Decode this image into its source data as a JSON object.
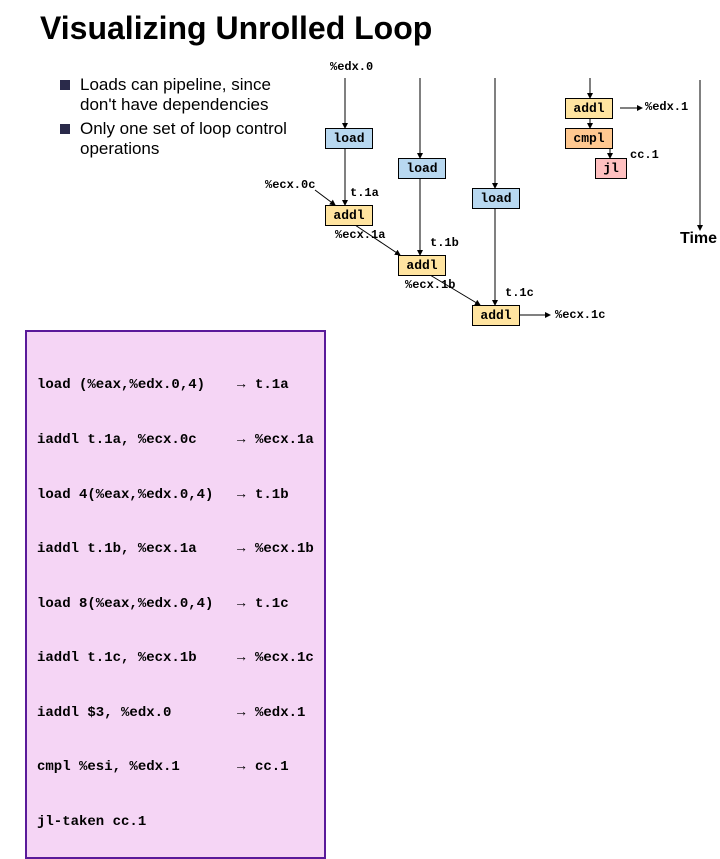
{
  "title": "Visualizing Unrolled Loop",
  "bullets": [
    "Loads can pipeline, since don't have dependencies",
    "Only one set of loop control operations"
  ],
  "code": {
    "lines": [
      {
        "l": "load (%eax,%edx.0,4)",
        "a": "→",
        "r": "t.1a"
      },
      {
        "l": "iaddl t.1a, %ecx.0c",
        "a": "→",
        "r": "%ecx.1a"
      },
      {
        "l": "load 4(%eax,%edx.0,4)",
        "a": "→",
        "r": "t.1b"
      },
      {
        "l": "iaddl t.1b, %ecx.1a",
        "a": "→",
        "r": "%ecx.1b"
      },
      {
        "l": "load 8(%eax,%edx.0,4)",
        "a": "→",
        "r": "t.1c"
      },
      {
        "l": "iaddl t.1c, %ecx.1b",
        "a": "→",
        "r": "%ecx.1c"
      },
      {
        "l": "iaddl $3, %edx.0",
        "a": "→",
        "r": "%edx.1"
      },
      {
        "l": "cmpl %esi, %edx.1",
        "a": "→",
        "r": "cc.1"
      },
      {
        "l": "jl-taken cc.1",
        "a": "",
        "r": ""
      }
    ]
  },
  "diagram": {
    "top_label": "%edx.0",
    "boxes": {
      "load1": "load",
      "load2": "load",
      "load3": "load",
      "addl_top": "addl",
      "cmpl": "cmpl",
      "jl": "jl",
      "addl1": "addl",
      "addl2": "addl",
      "addl3": "addl"
    },
    "labels": {
      "edx1": "%edx.1",
      "cc1": "cc.1",
      "ecx0c": "%ecx.0c",
      "t1a": "t.1a",
      "ecx1a": "%ecx.1a",
      "t1b": "t.1b",
      "ecx1b": "%ecx.1b",
      "t1c": "t.1c",
      "ecx1c": "%ecx.1c",
      "time": "Time"
    }
  }
}
